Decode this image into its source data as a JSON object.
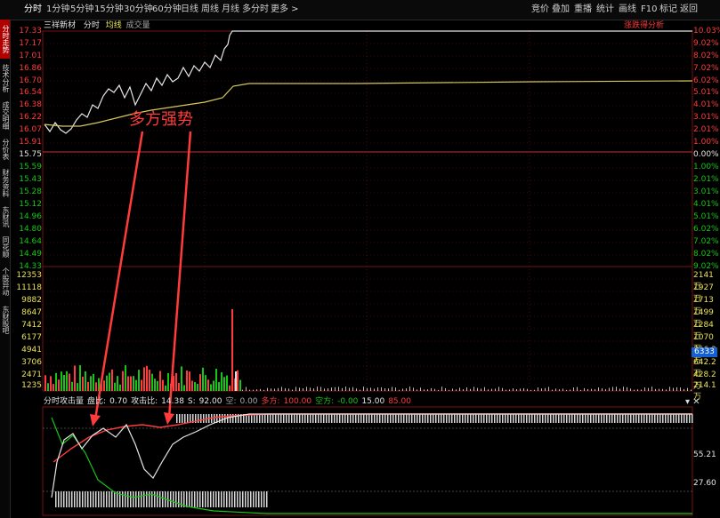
{
  "toolbar": {
    "left_tabs": [
      "分时",
      "1分钟",
      "5分钟",
      "15分钟",
      "30分钟",
      "60分钟",
      "日线",
      "周线",
      "月线",
      "多分时",
      "更多 >"
    ],
    "right_tabs": [
      "竞价",
      "叠加",
      "重播",
      "统计",
      "画线",
      "F10",
      "标记",
      "返回"
    ]
  },
  "side_tabs": [
    "分时走势",
    "技术分析",
    "成交明细",
    "分价表",
    "财务资料",
    "东财讯",
    "同花顺",
    "个股异动",
    "东财股吧"
  ],
  "title": {
    "stock": "三祥新材",
    "mode": "分时",
    "avg": "均线",
    "vol": "成交量",
    "right": "涨跌得分析"
  },
  "price_axis": {
    "left_up": [
      "17.33",
      "17.17",
      "17.01",
      "16.86",
      "16.70",
      "16.54",
      "16.38",
      "16.22",
      "16.07",
      "15.91"
    ],
    "mid": "15.75",
    "left_down": [
      "15.59",
      "15.43",
      "15.28",
      "15.12",
      "14.96",
      "14.80",
      "14.64",
      "14.49",
      "14.33"
    ],
    "right_up": [
      "10.03%",
      "9.02%",
      "8.02%",
      "7.02%",
      "6.02%",
      "5.01%",
      "4.01%",
      "3.01%",
      "2.01%",
      "1.00%"
    ],
    "right_mid": "0.00%",
    "right_down": [
      "1.00%",
      "2.01%",
      "3.01%",
      "4.01%",
      "5.01%",
      "6.02%",
      "7.02%",
      "8.02%",
      "9.02%"
    ]
  },
  "volume_axis": {
    "left": [
      "12353",
      "11118",
      "9882",
      "8647",
      "7412",
      "6177",
      "4941",
      "3706",
      "2471",
      "1235"
    ],
    "right": [
      "2141万",
      "1927万",
      "1713万",
      "1499万",
      "1284万",
      "1070万",
      "856.3万",
      "642.2万",
      "428.2万",
      "214.1万"
    ],
    "marker": "6333"
  },
  "indicator": {
    "name": "分时攻击量",
    "panbi_label": "盘比:",
    "panbi": "0.70",
    "gongji_label": "攻击比:",
    "gongji": "14.38",
    "s_label": "S:",
    "s": "92.00",
    "kong_label": "空:",
    "kong": "0.00",
    "duofang_label": "多方:",
    "duofang": "100.00",
    "kongfang_label": "空方:",
    "kongfang": "-0.00",
    "v1": "15.00",
    "v2": "85.00",
    "axis_right": [
      "55.21",
      "27.60"
    ]
  },
  "annotation": "多方强势",
  "colors": {
    "up": "#ff3b3b",
    "down": "#17c517",
    "price_line": "#e6e6e6",
    "avg_line": "#d6c85a",
    "grid": "#7a1010"
  }
}
